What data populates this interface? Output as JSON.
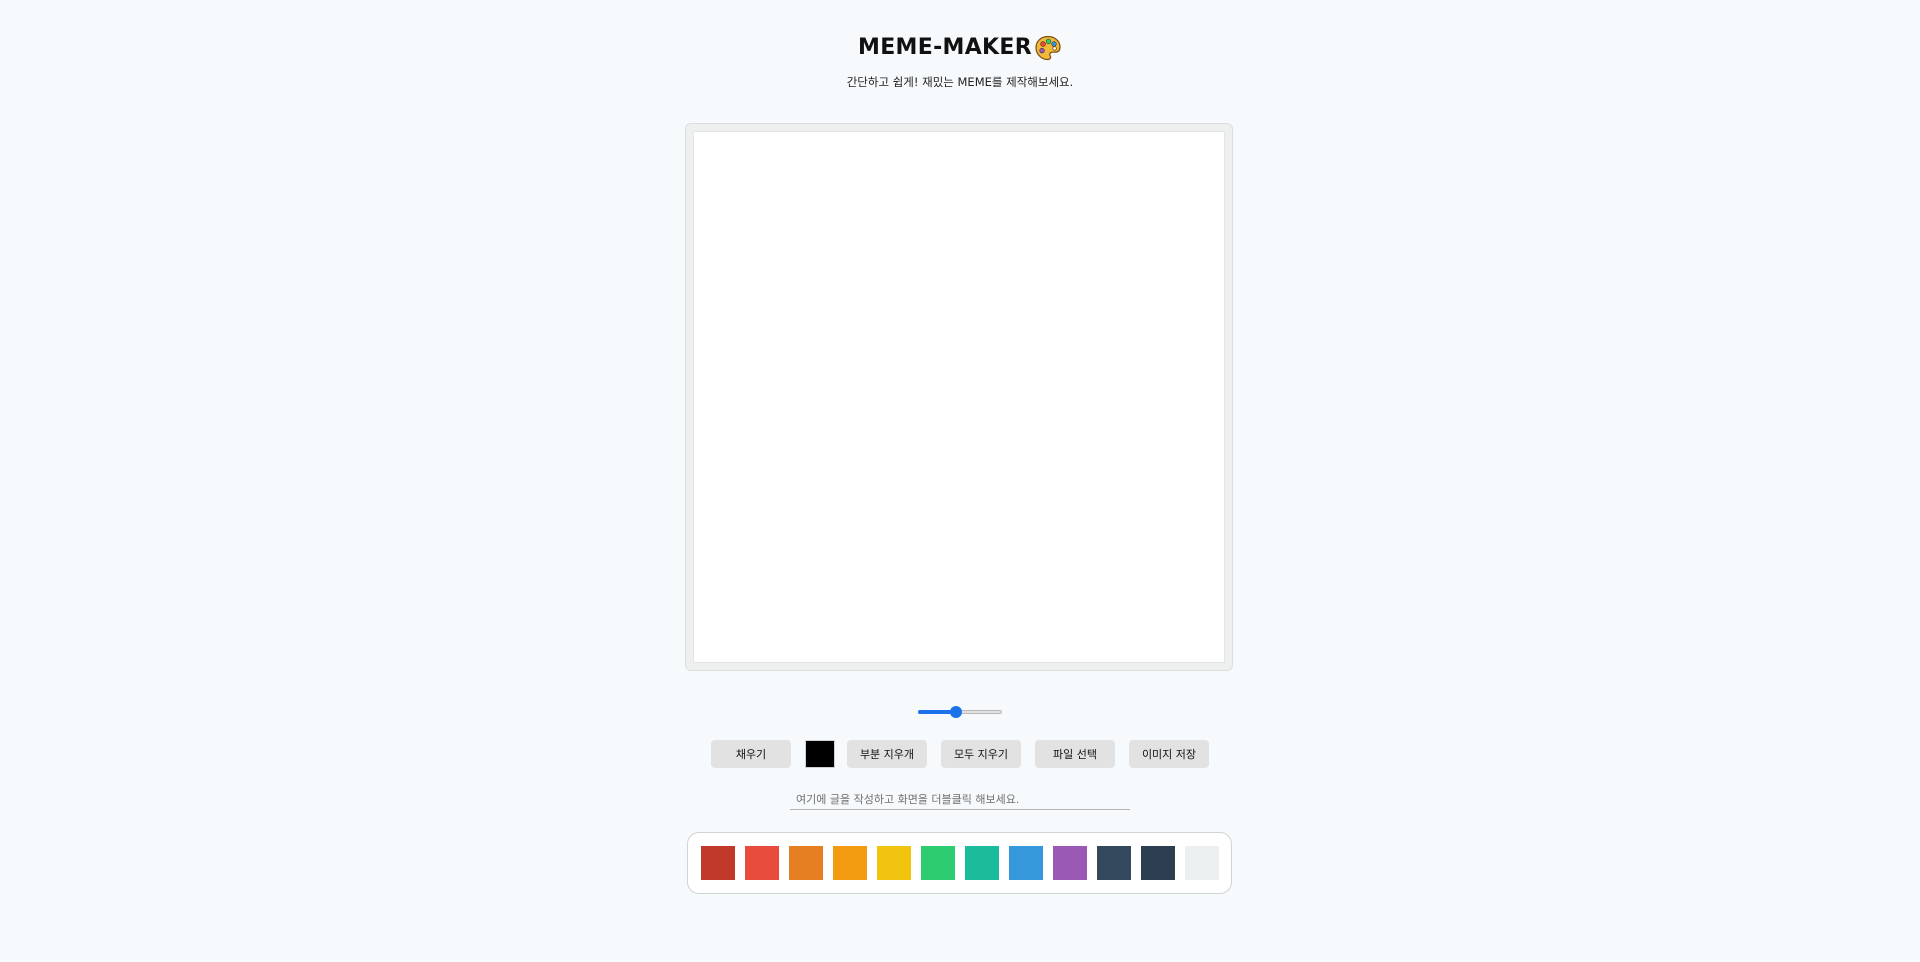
{
  "app": {
    "title": "MEME-MAKER",
    "title_icon": "artist-palette-icon",
    "subtitle": "간단하고 쉽게! 재밌는 MEME를 제작해보세요."
  },
  "brush": {
    "line_width_fraction": 0.45,
    "accent_color": "#1a73e8"
  },
  "toolbar": {
    "fill_label": "채우기",
    "current_color": "#000000",
    "eraser_label": "부분 지우개",
    "clear_all_label": "모두 지우기",
    "file_label": "파일 선택",
    "save_label": "이미지 저장"
  },
  "text_input": {
    "value": "",
    "placeholder": "여기에 글을 작성하고 화면을 더블클릭 해보세요."
  },
  "palette": {
    "colors": [
      "#c0392b",
      "#e74c3c",
      "#e67e22",
      "#f39c12",
      "#f1c40f",
      "#2ecc71",
      "#1abc9c",
      "#3498db",
      "#9b59b6",
      "#34495e",
      "#2c3e50",
      "#ecf0f1"
    ]
  }
}
